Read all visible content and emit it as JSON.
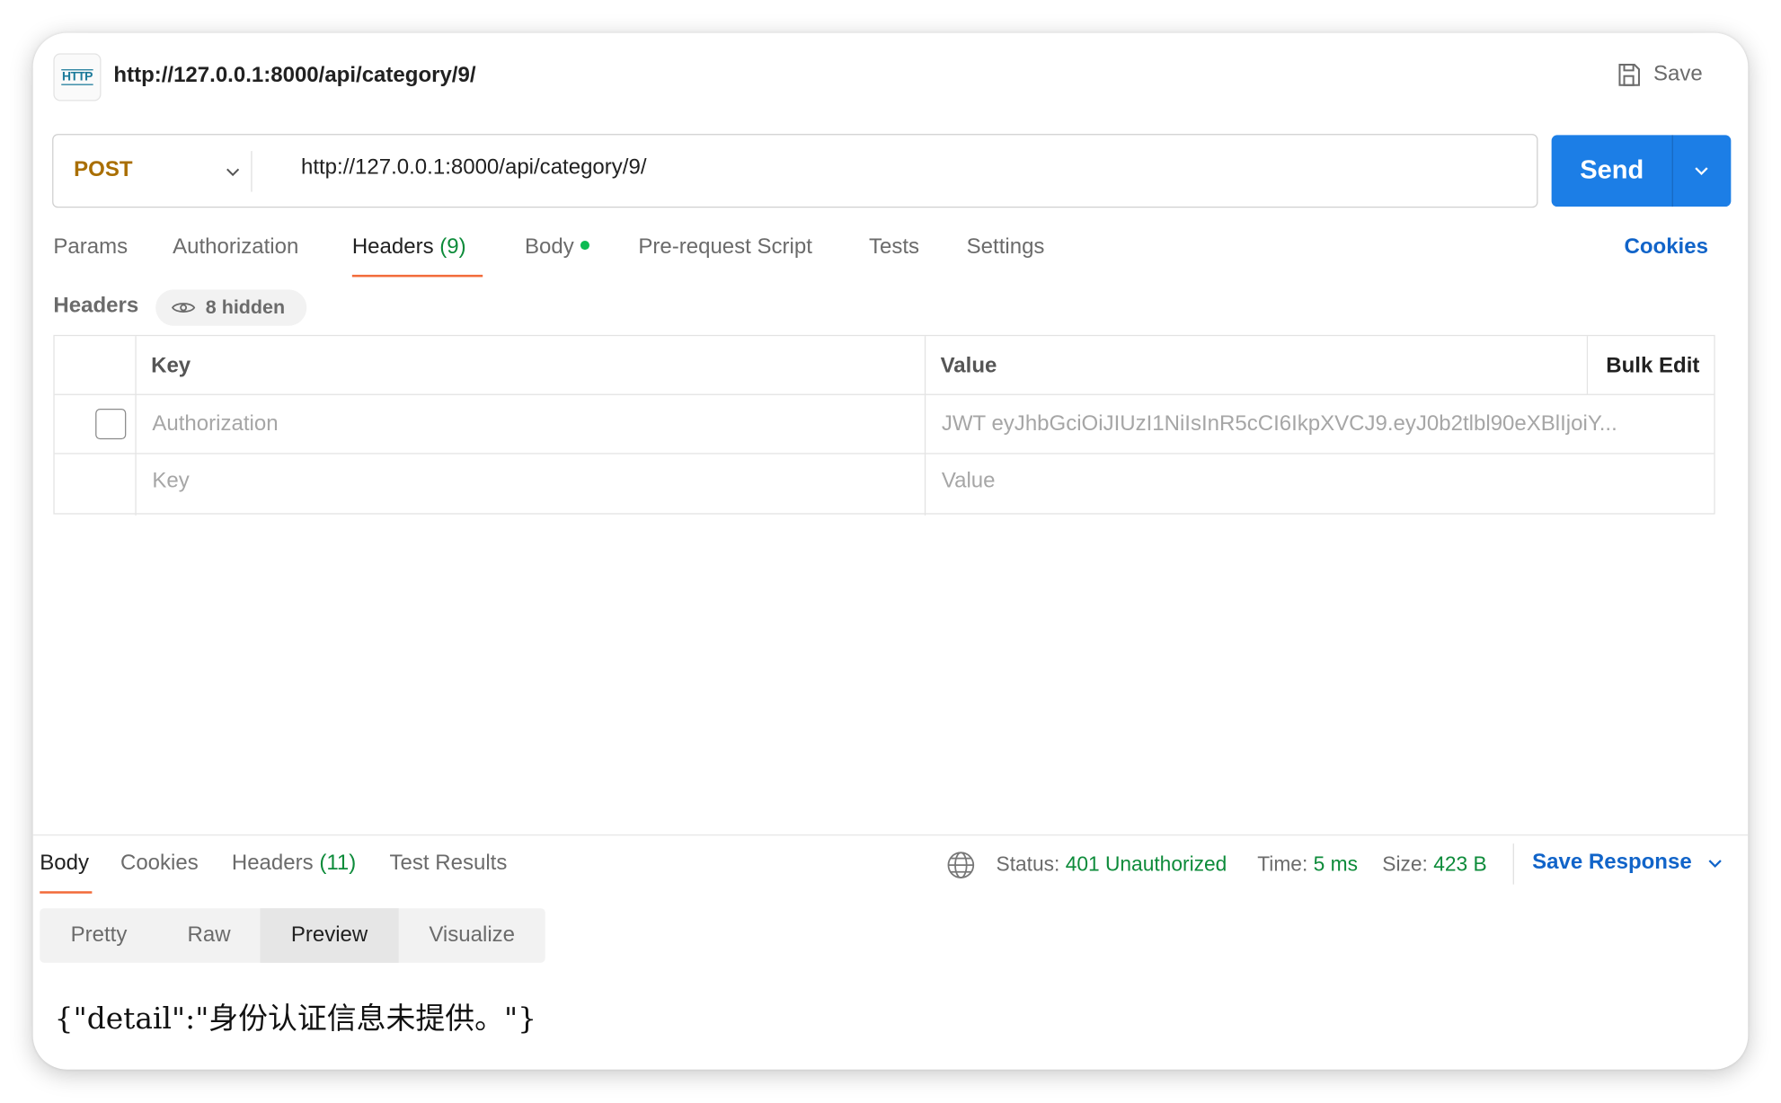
{
  "request": {
    "title": "http://127.0.0.1:8000/api/category/9/",
    "icon_label": "HTTP",
    "save_label": "Save",
    "method": "POST",
    "url": "http://127.0.0.1:8000/api/category/9/",
    "send_label": "Send"
  },
  "request_tabs": {
    "params": "Params",
    "authorization": "Authorization",
    "headers": "Headers",
    "headers_count": "(9)",
    "body": "Body",
    "prerequest": "Pre-request Script",
    "tests": "Tests",
    "settings": "Settings",
    "cookies": "Cookies"
  },
  "headers_section": {
    "label": "Headers",
    "hidden_label": "8 hidden",
    "col_key": "Key",
    "col_value": "Value",
    "bulk_edit": "Bulk Edit",
    "rows": [
      {
        "key": "Authorization",
        "value": "JWT eyJhbGciOiJIUzI1NiIsInR5cCI6IkpXVCJ9.eyJ0b2tlbl90eXBlIjoiY..."
      }
    ],
    "placeholder_key": "Key",
    "placeholder_value": "Value"
  },
  "response": {
    "tabs": {
      "body": "Body",
      "cookies": "Cookies",
      "headers": "Headers",
      "headers_count": "(11)",
      "test_results": "Test Results"
    },
    "status_label": "Status:",
    "status_value": "401 Unauthorized",
    "time_label": "Time:",
    "time_value": "5 ms",
    "size_label": "Size:",
    "size_value": "423 B",
    "save_response": "Save Response",
    "views": [
      "Pretty",
      "Raw",
      "Preview",
      "Visualize"
    ],
    "active_view": "Preview",
    "body_text": "{\"detail\":\"身份认证信息未提供。\"}"
  },
  "colors": {
    "accent": "#1c7ee6",
    "method": "#a96e00",
    "status_ok": "#0d8b3a",
    "tab_underline": "#f26b3a",
    "link": "#1164c9"
  }
}
